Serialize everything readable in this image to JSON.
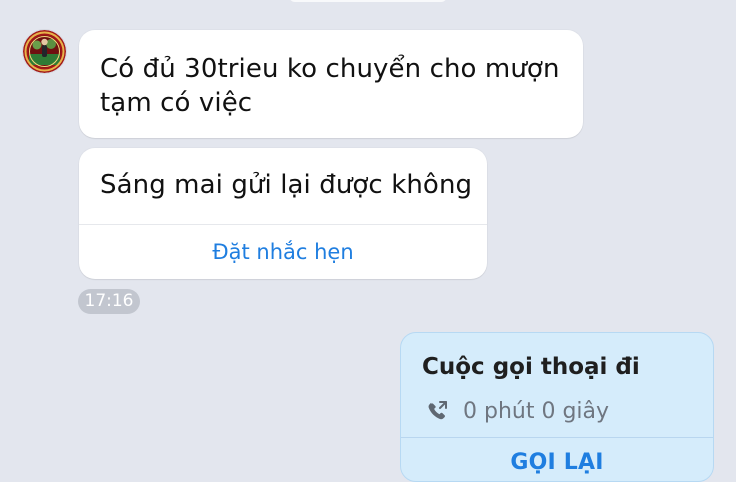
{
  "chat": {
    "messages": [
      {
        "text": "Có đủ 30trieu ko chuyển cho mượn\ntạm có việc"
      },
      {
        "text": "Sáng mai gửi lại được không",
        "reminder_action": "Đặt nhắc hẹn"
      }
    ],
    "timestamp": "17:16",
    "call_card": {
      "title": "Cuộc gọi thoại đi",
      "duration": "0 phút 0 giây",
      "callback_label": "GỌI LẠI"
    }
  },
  "colors": {
    "background": "#e3e6ee",
    "incoming_bubble": "#ffffff",
    "outgoing_bubble": "#d5ecfb",
    "accent": "#1f7ee0",
    "timestamp_badge": "#c2c6cf"
  },
  "icons": {
    "avatar": "profile-avatar",
    "call": "phone-outgoing-icon"
  }
}
